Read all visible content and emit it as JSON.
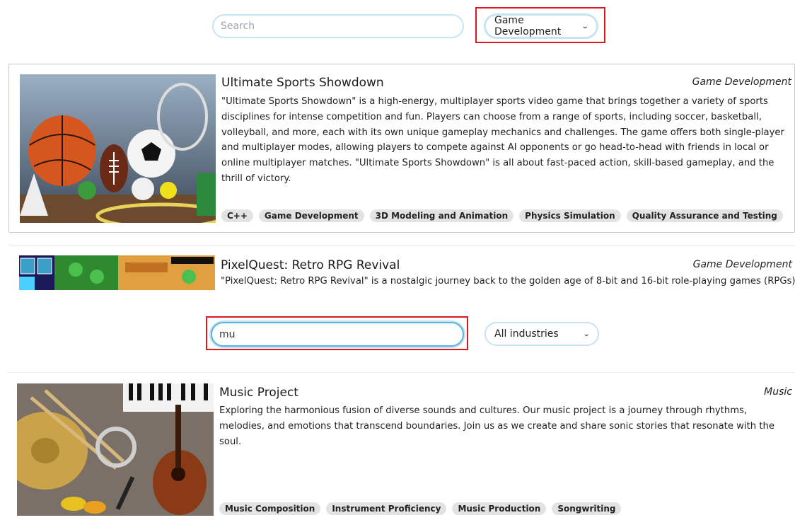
{
  "top_panel": {
    "search": {
      "placeholder": "Search",
      "value": ""
    },
    "industry_select": {
      "selected": "Game Development"
    },
    "projects": [
      {
        "title": "Ultimate Sports Showdown",
        "industry": "Game Development",
        "description": "\"Ultimate Sports Showdown\" is a high-energy, multiplayer sports video game that brings together a variety of sports disciplines for intense competition and fun. Players can choose from a range of sports, including soccer, basketball, volleyball, and more, each with its own unique gameplay mechanics and challenges. The game offers both single-player and multiplayer modes, allowing players to compete against AI opponents or go head-to-head with friends in local or online multiplayer matches. \"Ultimate Sports Showdown\" is all about fast-paced action, skill-based gameplay, and the thrill of victory.",
        "tags": [
          "C++",
          "Game Development",
          "3D Modeling and Animation",
          "Physics Simulation",
          "Quality Assurance and Testing"
        ]
      },
      {
        "title": "PixelQuest: Retro RPG Revival",
        "industry": "Game Development",
        "description": "\"PixelQuest: Retro RPG Revival\" is a nostalgic journey back to the golden age of 8-bit and 16-bit role-playing games (RPGs)."
      }
    ]
  },
  "bottom_panel": {
    "search": {
      "value": "mu"
    },
    "industry_select": {
      "selected": "All industries"
    },
    "projects": [
      {
        "title": "Music Project",
        "industry": "Music",
        "description": "Exploring the harmonious fusion of diverse sounds and cultures. Our music project is a journey through rhythms, melodies, and emotions that transcend boundaries. Join us as we create and share sonic stories that resonate with the soul.",
        "tags": [
          "Music Composition",
          "Instrument Proficiency",
          "Music Production",
          "Songwriting"
        ]
      }
    ]
  }
}
